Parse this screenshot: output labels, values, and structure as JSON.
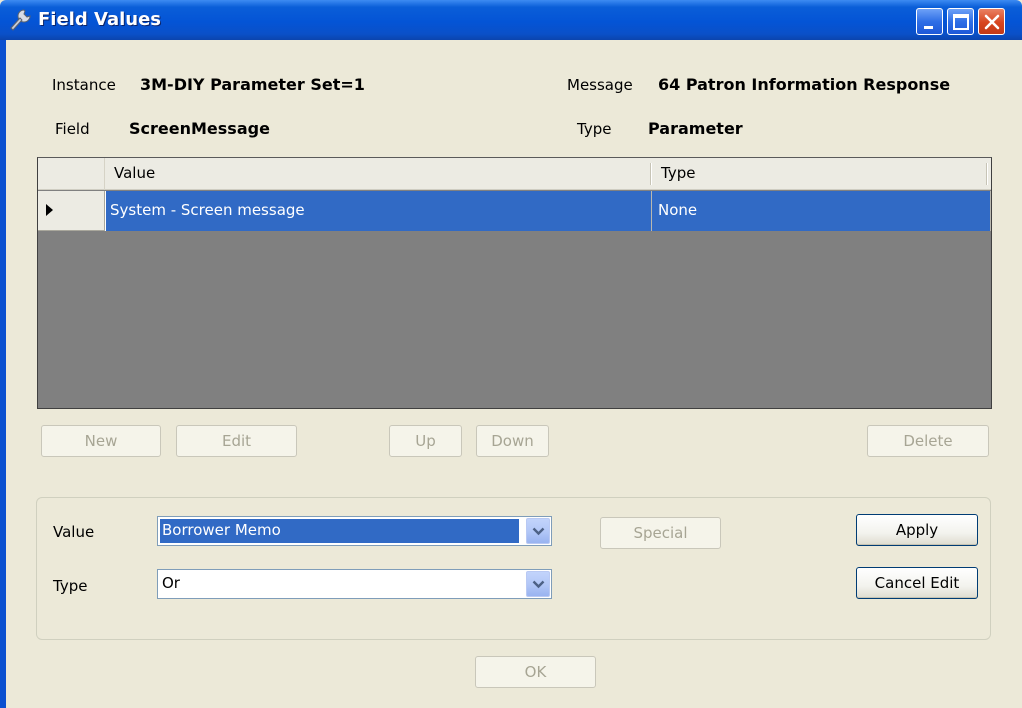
{
  "window": {
    "title": "Field Values"
  },
  "info": {
    "instance_label": "Instance",
    "instance_value": "3M-DIY Parameter Set=1",
    "message_label": "Message",
    "message_value": "64 Patron Information Response",
    "field_label": "Field",
    "field_value": "ScreenMessage",
    "type_label": "Type",
    "type_value": "Parameter"
  },
  "grid": {
    "columns": [
      "Value",
      "Type"
    ],
    "rows": [
      {
        "value": "System - Screen message",
        "type": "None"
      }
    ]
  },
  "buttons": {
    "new": "New",
    "edit": "Edit",
    "up": "Up",
    "down": "Down",
    "delete": "Delete",
    "special": "Special",
    "apply": "Apply",
    "cancel_edit": "Cancel Edit",
    "ok": "OK"
  },
  "edit_panel": {
    "value_label": "Value",
    "value_selected": "Borrower Memo",
    "type_label": "Type",
    "type_selected": "Or"
  },
  "icons": {
    "title": "wrench-icon",
    "dropdown": "chevron-down-icon"
  },
  "colors": {
    "titlebar": "#0454d6",
    "selection": "#316ac5",
    "dialog_bg": "#ece9d8",
    "grid_bg": "#808080"
  }
}
